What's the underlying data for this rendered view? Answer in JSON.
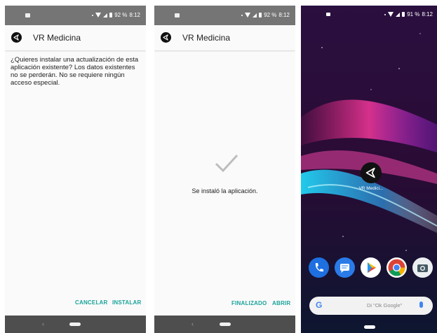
{
  "screens": [
    {
      "status": {
        "battery_pct": "92 %",
        "time": "8:12"
      },
      "app_title": "VR Medicina",
      "message": "¿Quieres instalar una actualización de esta aplicación existente? Los datos existentes no se perderán. No se requiere ningún acceso especial.",
      "buttons": {
        "cancel": "CANCELAR",
        "install": "INSTALAR"
      }
    },
    {
      "status": {
        "battery_pct": "92 %",
        "time": "8:12"
      },
      "app_title": "VR Medicina",
      "success_text": "Se instaló la aplicación.",
      "buttons": {
        "done": "FINALIZADO",
        "open": "ABRIR"
      }
    },
    {
      "status": {
        "battery_pct": "91 %",
        "time": "8:12"
      },
      "shortcut_label": "VR Medici...",
      "dock_icons": [
        "phone-icon",
        "messages-icon",
        "play-store-icon",
        "chrome-icon",
        "camera-icon"
      ],
      "search": {
        "logo": "G",
        "placeholder": "Di \"Ok Google\""
      }
    }
  ],
  "colors": {
    "accent": "#1aa39a",
    "statusbar": "#757575",
    "navbar": "#4e4e4e"
  }
}
